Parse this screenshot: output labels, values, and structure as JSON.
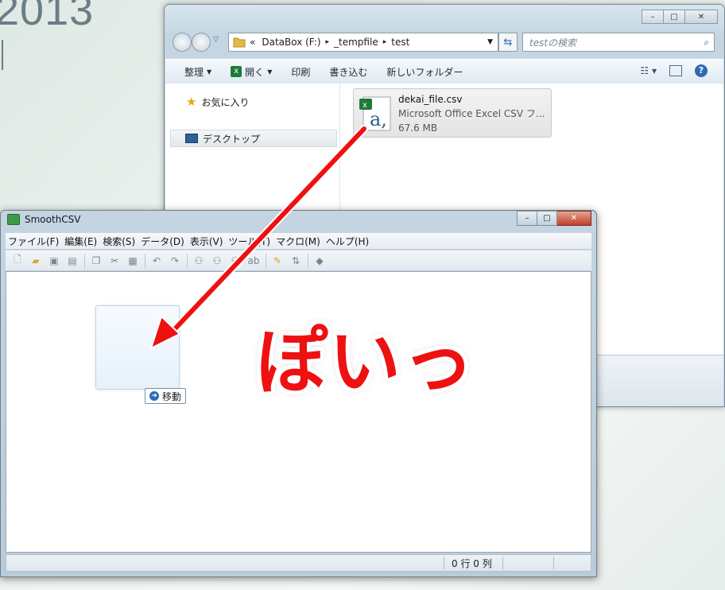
{
  "desktop": {
    "year": "2013"
  },
  "explorer": {
    "window_controls": [
      "–",
      "□",
      "✕"
    ],
    "breadcrumb": [
      "«",
      "DataBox (F:)",
      "_tempfile",
      "test"
    ],
    "search_placeholder": "testの検索",
    "commands": [
      "整理",
      "開く",
      "印刷",
      "書き込む",
      "新しいフォルダー"
    ],
    "nav": {
      "favorites": "お気に入り",
      "desktop": "デスクトップ"
    },
    "file": {
      "name": "dekai_file.csv",
      "type": "Microsoft Office Excel CSV フ...",
      "size": "67.6 MB"
    }
  },
  "smoothcsv": {
    "title": "SmoothCSV",
    "menu": [
      "ファイル(F)",
      "編集(E)",
      "検索(S)",
      "データ(D)",
      "表示(V)",
      "ツール(T)",
      "マクロ(M)",
      "ヘルプ(H)"
    ],
    "status": "0 行 0 列"
  },
  "drag": {
    "tooltip": "移動",
    "annotation": "ぽいっ"
  },
  "colors": {
    "annotation": "#ee1111",
    "arrow": "#ee1111",
    "accent": "#2d6ab3"
  },
  "icons": [
    "back-icon",
    "forward-icon",
    "folder-icon",
    "refresh-icon",
    "search-icon",
    "excel-icon",
    "star-icon",
    "desktop-icon",
    "csv-file-icon",
    "move-arrow-icon"
  ]
}
